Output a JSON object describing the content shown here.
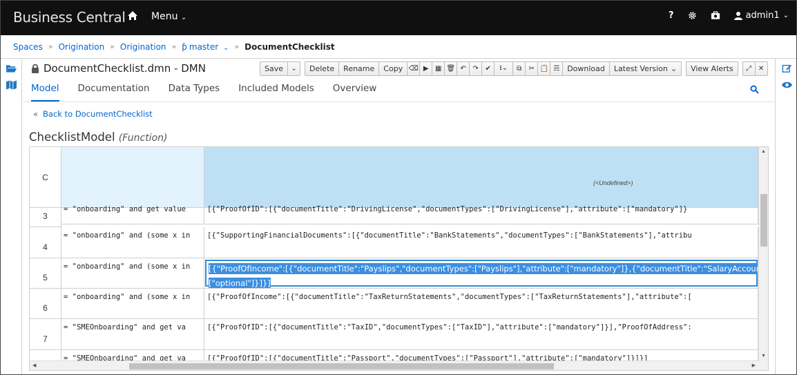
{
  "navbar": {
    "brand": "Business Central",
    "menu_label": "Menu",
    "help_label": "?",
    "user_label": "admin1"
  },
  "breadcrumb": {
    "items": [
      "Spaces",
      "Origination",
      "Origination",
      "master"
    ],
    "current": "DocumentChecklist",
    "separator": "»"
  },
  "editor": {
    "title": "DocumentChecklist.dmn - DMN",
    "toolbar": {
      "save": "Save",
      "delete": "Delete",
      "rename": "Rename",
      "copy": "Copy",
      "download": "Download",
      "latest_version": "Latest Version",
      "view_alerts": "View Alerts"
    }
  },
  "tabs": [
    {
      "label": "Model",
      "active": true
    },
    {
      "label": "Documentation",
      "active": false
    },
    {
      "label": "Data Types",
      "active": false
    },
    {
      "label": "Included Models",
      "active": false
    },
    {
      "label": "Overview",
      "active": false
    }
  ],
  "back_link": "Back to DocumentChecklist",
  "function": {
    "name": "ChecklistModel",
    "kind": "(Function)"
  },
  "grid": {
    "header_col": "C",
    "header_value": "(<Undefined>)",
    "rows": [
      {
        "num": "3",
        "key": "= \"onboarding\" and get value",
        "value": "[{\"ProofOfID\":[{\"documentTitle\":\"DrivingLicense\",\"documentTypes\":[\"DrivingLicense\"],\"attribute\":[\"mandatory\"]}"
      },
      {
        "num": "4",
        "key": "= \"onboarding\" and (some x in",
        "value": "[{\"SupportingFinancialDocuments\":[{\"documentTitle\":\"BankStatements\",\"documentTypes\":[\"BankStatements\"],\"attribu"
      },
      {
        "num": "5",
        "key": "= \"onboarding\" and (some x in",
        "value": "[{\"ProofOfIncome\":[{\"documentTitle\":\"Payslips\",\"documentTypes\":[\"Payslips\"],\"attribute\":[\"mandatory\"]},{\"documentTitle\":\"SalaryAccountStatem",
        "value_line2": "[\"optional\"]}]}]"
      },
      {
        "num": "6",
        "key": "= \"onboarding\" and (some x in",
        "value": "[{\"ProofOfIncome\":[{\"documentTitle\":\"TaxReturnStatements\",\"documentTypes\":[\"TaxReturnStatements\"],\"attribute\":["
      },
      {
        "num": "7",
        "key": "= \"SMEOnboarding\" and get va",
        "value": "[{\"ProofOfID\":[{\"documentTitle\":\"TaxID\",\"documentTypes\":[\"TaxID\"],\"attribute\":[\"mandatory\"]}],\"ProofOfAddress\":"
      },
      {
        "num": "8",
        "key": "= \"SMEOnboarding\" and get va",
        "value": "[{\"ProofOfID\":[{\"documentTitle\":\"Passport\",\"documentTypes\":[\"Passport\"],\"attribute\":[\"mandatory\"]}]}]"
      }
    ]
  }
}
